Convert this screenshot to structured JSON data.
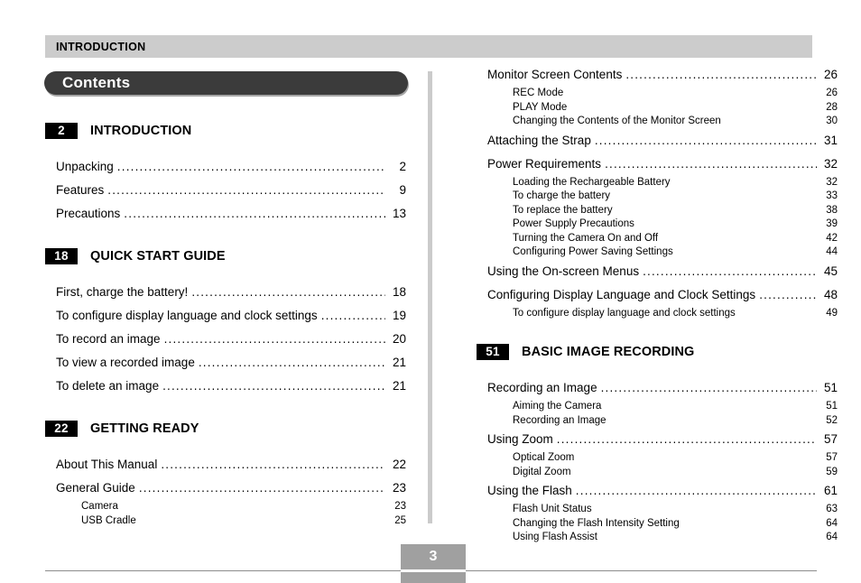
{
  "running_head": {
    "text": "INTRODUCTION"
  },
  "title_bar": {
    "text": "Contents"
  },
  "footer": {
    "page_number": "3"
  },
  "colors": {
    "running_head_bg": "#cccccc",
    "title_bar_bg": "#3b3b3b",
    "badge_bg": "#000000",
    "divider": "#cbcbcb",
    "footer_box": "#a0a0a0"
  },
  "left_column": {
    "sections": [
      {
        "badge": "2",
        "title": "INTRODUCTION",
        "entries": [
          {
            "level": 1,
            "label": "Unpacking",
            "page": "2"
          },
          {
            "level": 1,
            "label": "Features",
            "page": "9"
          },
          {
            "level": 1,
            "label": "Precautions",
            "page": "13"
          }
        ]
      },
      {
        "badge": "18",
        "title": "QUICK START GUIDE",
        "entries": [
          {
            "level": 1,
            "label": "First, charge the battery!",
            "page": "18"
          },
          {
            "level": 1,
            "label": "To configure display language and clock settings",
            "page": "19"
          },
          {
            "level": 1,
            "label": "To record an image",
            "page": "20"
          },
          {
            "level": 1,
            "label": "To view a recorded image",
            "page": "21"
          },
          {
            "level": 1,
            "label": "To delete an image",
            "page": "21"
          }
        ]
      },
      {
        "badge": "22",
        "title": "GETTING READY",
        "entries": [
          {
            "level": 1,
            "label": "About This Manual",
            "page": "22"
          },
          {
            "level": 1,
            "label": "General Guide",
            "page": "23"
          },
          {
            "level": 2,
            "label": "Camera",
            "page": "23"
          },
          {
            "level": 2,
            "label": "USB Cradle",
            "page": "25"
          }
        ]
      }
    ]
  },
  "right_column": {
    "sections": [
      {
        "badge": "",
        "title": "",
        "entries": [
          {
            "level": 1,
            "label": "Monitor Screen Contents",
            "page": "26"
          },
          {
            "level": 2,
            "label": "REC Mode",
            "page": "26"
          },
          {
            "level": 2,
            "label": "PLAY Mode",
            "page": "28"
          },
          {
            "level": 2,
            "label": "Changing the Contents of the Monitor Screen",
            "page": "30"
          },
          {
            "level": 1,
            "label": "Attaching the Strap",
            "page": "31"
          },
          {
            "level": 1,
            "label": "Power Requirements",
            "page": "32"
          },
          {
            "level": 2,
            "label": "Loading the Rechargeable Battery",
            "page": "32"
          },
          {
            "level": 2,
            "label": "To charge the battery",
            "page": "33"
          },
          {
            "level": 2,
            "label": "To replace the battery",
            "page": "38"
          },
          {
            "level": 2,
            "label": "Power Supply Precautions",
            "page": "39"
          },
          {
            "level": 2,
            "label": "Turning the Camera On and Off",
            "page": "42"
          },
          {
            "level": 2,
            "label": "Configuring Power Saving Settings",
            "page": "44"
          },
          {
            "level": 1,
            "label": "Using the On-screen Menus",
            "page": "45"
          },
          {
            "level": 1,
            "label": "Configuring Display Language and Clock Settings",
            "page": "48"
          },
          {
            "level": 2,
            "label": "To configure display language and clock settings",
            "page": "49"
          }
        ]
      },
      {
        "badge": "51",
        "title": "BASIC IMAGE RECORDING",
        "entries": [
          {
            "level": 1,
            "label": "Recording an Image",
            "page": "51"
          },
          {
            "level": 2,
            "label": "Aiming the Camera",
            "page": "51"
          },
          {
            "level": 2,
            "label": "Recording an Image",
            "page": "52"
          },
          {
            "level": 1,
            "label": "Using Zoom",
            "page": "57"
          },
          {
            "level": 2,
            "label": "Optical Zoom",
            "page": "57"
          },
          {
            "level": 2,
            "label": "Digital Zoom",
            "page": "59"
          },
          {
            "level": 1,
            "label": "Using the Flash",
            "page": "61"
          },
          {
            "level": 2,
            "label": "Flash Unit Status",
            "page": "63"
          },
          {
            "level": 2,
            "label": "Changing the Flash Intensity Setting",
            "page": "64"
          },
          {
            "level": 2,
            "label": "Using Flash Assist",
            "page": "64"
          }
        ]
      }
    ]
  }
}
